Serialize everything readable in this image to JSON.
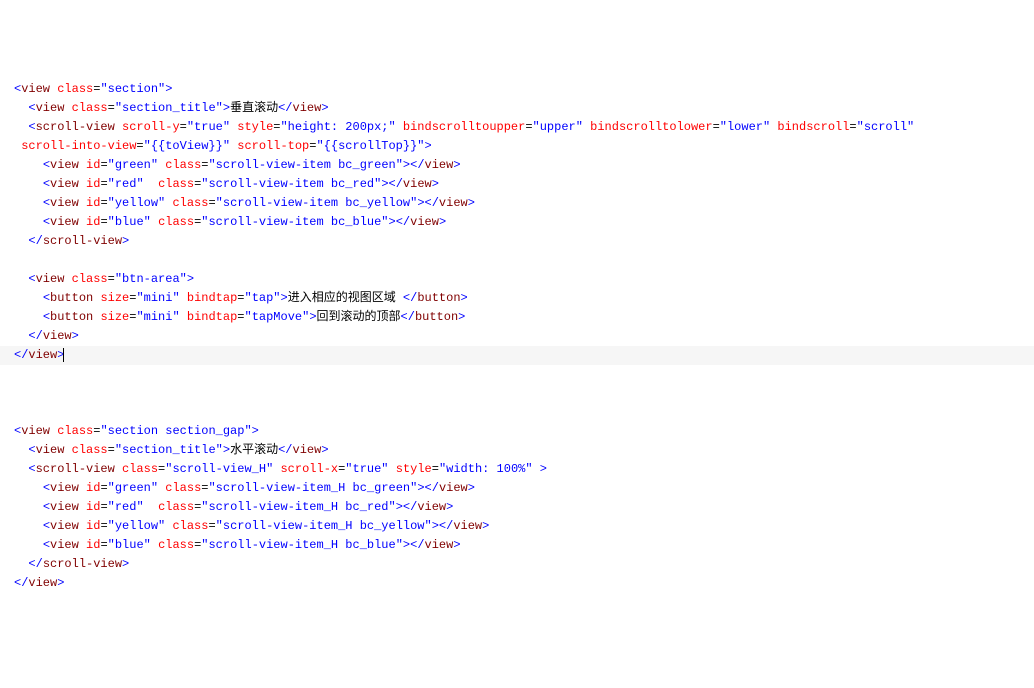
{
  "lines": [
    {
      "indent": 0,
      "segments": [
        {
          "t": "open",
          "tag": "view",
          "attrs": [
            [
              "class",
              "section"
            ]
          ]
        }
      ]
    },
    {
      "indent": 2,
      "segments": [
        {
          "t": "open",
          "tag": "view",
          "attrs": [
            [
              "class",
              "section_title"
            ]
          ]
        },
        {
          "t": "text",
          "v": "垂直滚动"
        },
        {
          "t": "close",
          "tag": "view"
        }
      ]
    },
    {
      "indent": 2,
      "segments": [
        {
          "t": "open",
          "tag": "scroll-view",
          "attrs": [
            [
              "scroll-y",
              "true"
            ],
            [
              "style",
              "height: 200px;"
            ],
            [
              "bindscrolltoupper",
              "upper"
            ],
            [
              "bindscrolltolower",
              "lower"
            ],
            [
              "bindscroll",
              "scroll"
            ]
          ]
        }
      ],
      "nolast": true
    },
    {
      "indent": 0,
      "cont": true,
      "segments": [
        {
          "t": "attrcont",
          "attrs": [
            [
              "scroll-into-view",
              "{{toView}}"
            ],
            [
              "scroll-top",
              "{{scrollTop}}"
            ]
          ]
        }
      ]
    },
    {
      "indent": 4,
      "segments": [
        {
          "t": "open",
          "tag": "view",
          "attrs": [
            [
              "id",
              "green"
            ],
            [
              "class",
              "scroll-view-item bc_green"
            ]
          ]
        },
        {
          "t": "close",
          "tag": "view"
        }
      ]
    },
    {
      "indent": 4,
      "segments": [
        {
          "t": "open",
          "tag": "view",
          "attrs": [
            [
              "id",
              "red"
            ],
            [
              "class",
              "scroll-view-item bc_red"
            ]
          ],
          "padafter": [
            1,
            2
          ]
        },
        {
          "t": "close",
          "tag": "view"
        }
      ]
    },
    {
      "indent": 4,
      "segments": [
        {
          "t": "open",
          "tag": "view",
          "attrs": [
            [
              "id",
              "yellow"
            ],
            [
              "class",
              "scroll-view-item bc_yellow"
            ]
          ]
        },
        {
          "t": "close",
          "tag": "view"
        }
      ]
    },
    {
      "indent": 4,
      "segments": [
        {
          "t": "open",
          "tag": "view",
          "attrs": [
            [
              "id",
              "blue"
            ],
            [
              "class",
              "scroll-view-item bc_blue"
            ]
          ]
        },
        {
          "t": "close",
          "tag": "view"
        }
      ]
    },
    {
      "indent": 2,
      "segments": [
        {
          "t": "close",
          "tag": "scroll-view"
        }
      ]
    },
    {
      "blank": true
    },
    {
      "indent": 2,
      "segments": [
        {
          "t": "open",
          "tag": "view",
          "attrs": [
            [
              "class",
              "btn-area"
            ]
          ]
        }
      ]
    },
    {
      "indent": 4,
      "segments": [
        {
          "t": "open",
          "tag": "button",
          "attrs": [
            [
              "size",
              "mini"
            ],
            [
              "bindtap",
              "tap"
            ]
          ]
        },
        {
          "t": "text",
          "v": "进入相应的视图区域 "
        },
        {
          "t": "close",
          "tag": "button"
        }
      ]
    },
    {
      "indent": 4,
      "segments": [
        {
          "t": "open",
          "tag": "button",
          "attrs": [
            [
              "size",
              "mini"
            ],
            [
              "bindtap",
              "tapMove"
            ]
          ]
        },
        {
          "t": "text",
          "v": "回到滚动的顶部"
        },
        {
          "t": "close",
          "tag": "button"
        }
      ]
    },
    {
      "indent": 2,
      "segments": [
        {
          "t": "close",
          "tag": "view"
        }
      ]
    },
    {
      "indent": 0,
      "highlight": true,
      "cursor": true,
      "segments": [
        {
          "t": "close",
          "tag": "view"
        }
      ]
    },
    {
      "blank": true
    },
    {
      "blank": true
    },
    {
      "blank": true
    },
    {
      "indent": 0,
      "segments": [
        {
          "t": "open",
          "tag": "view",
          "attrs": [
            [
              "class",
              "section section_gap"
            ]
          ]
        }
      ]
    },
    {
      "indent": 2,
      "segments": [
        {
          "t": "open",
          "tag": "view",
          "attrs": [
            [
              "class",
              "section_title"
            ]
          ]
        },
        {
          "t": "text",
          "v": "水平滚动"
        },
        {
          "t": "close",
          "tag": "view"
        }
      ]
    },
    {
      "indent": 2,
      "segments": [
        {
          "t": "open",
          "tag": "scroll-view",
          "attrs": [
            [
              "class",
              "scroll-view_H"
            ],
            [
              "scroll-x",
              "true"
            ],
            [
              "style",
              "width: 100%"
            ]
          ],
          "trailspace": true
        }
      ]
    },
    {
      "indent": 4,
      "segments": [
        {
          "t": "open",
          "tag": "view",
          "attrs": [
            [
              "id",
              "green"
            ],
            [
              "class",
              "scroll-view-item_H bc_green"
            ]
          ]
        },
        {
          "t": "close",
          "tag": "view"
        }
      ]
    },
    {
      "indent": 4,
      "segments": [
        {
          "t": "open",
          "tag": "view",
          "attrs": [
            [
              "id",
              "red"
            ],
            [
              "class",
              "scroll-view-item_H bc_red"
            ]
          ],
          "padafter": [
            1,
            2
          ]
        },
        {
          "t": "close",
          "tag": "view"
        }
      ]
    },
    {
      "indent": 4,
      "segments": [
        {
          "t": "open",
          "tag": "view",
          "attrs": [
            [
              "id",
              "yellow"
            ],
            [
              "class",
              "scroll-view-item_H bc_yellow"
            ]
          ]
        },
        {
          "t": "close",
          "tag": "view"
        }
      ]
    },
    {
      "indent": 4,
      "segments": [
        {
          "t": "open",
          "tag": "view",
          "attrs": [
            [
              "id",
              "blue"
            ],
            [
              "class",
              "scroll-view-item_H bc_blue"
            ]
          ]
        },
        {
          "t": "close",
          "tag": "view"
        }
      ]
    },
    {
      "indent": 2,
      "segments": [
        {
          "t": "close",
          "tag": "scroll-view"
        }
      ]
    },
    {
      "indent": 0,
      "segments": [
        {
          "t": "close",
          "tag": "view"
        }
      ]
    }
  ]
}
